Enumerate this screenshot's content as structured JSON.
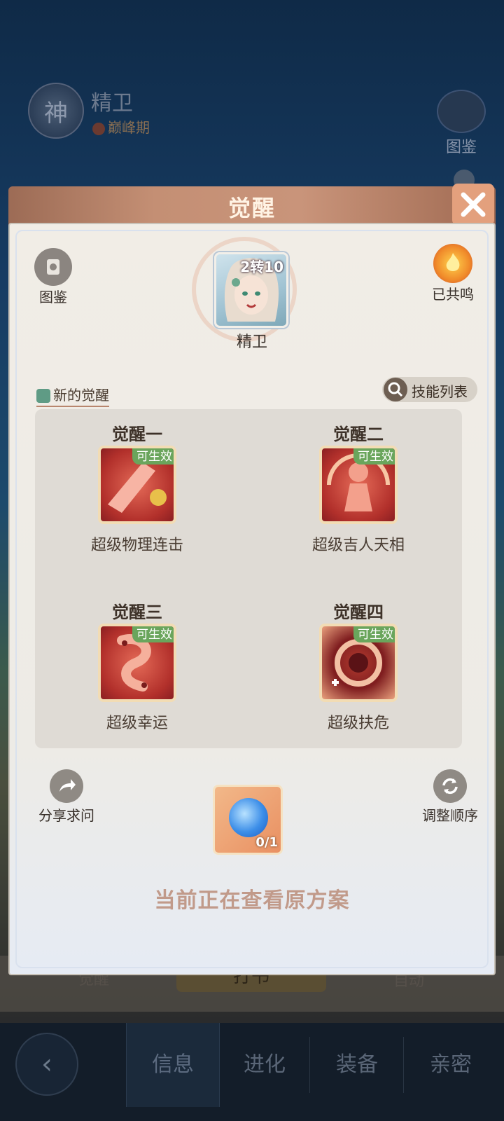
{
  "background": {
    "emblem": "神",
    "hero_name": "精卫",
    "hero_stage": "巅峰期",
    "atlas_label": "图鉴",
    "awaken_label": "觉醒",
    "main_button": "打书",
    "auto_label": "自动"
  },
  "nav": {
    "tabs": [
      "信息",
      "进化",
      "装备",
      "亲密"
    ],
    "active": "信息"
  },
  "modal": {
    "title": "觉醒",
    "atlas_label": "图鉴",
    "resonance_label": "已共鸣",
    "portrait_badge": "2转10",
    "char_name": "精卫",
    "new_awaken_label": "新的觉醒",
    "skill_list_label": "技能列表",
    "awakenings": [
      {
        "title": "觉醒一",
        "tag": "可生效",
        "name": "超级物理连击"
      },
      {
        "title": "觉醒二",
        "tag": "可生效",
        "name": "超级吉人天相"
      },
      {
        "title": "觉醒三",
        "tag": "可生效",
        "name": "超级幸运"
      },
      {
        "title": "觉醒四",
        "tag": "可生效",
        "name": "超级扶危"
      }
    ],
    "share_label": "分享求问",
    "order_label": "调整顺序",
    "orb_count": "0/1",
    "viewing_text": "当前正在查看原方案"
  }
}
